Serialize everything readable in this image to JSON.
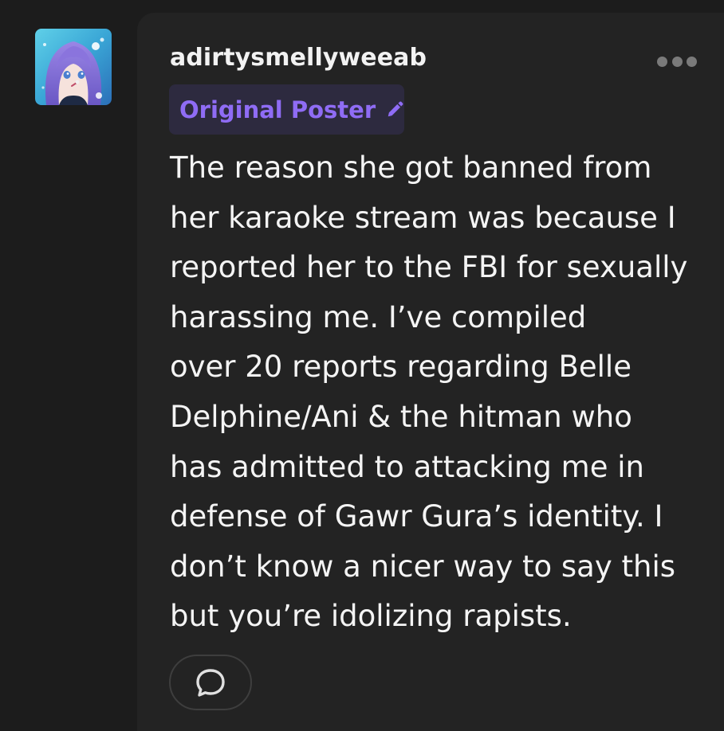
{
  "post": {
    "username": "adirtysmellyweeab",
    "badge": {
      "label": "Original Poster",
      "icon": "pencil-icon",
      "color": "#8f6cf5",
      "background": "#2d2a3f"
    },
    "avatar_icon": "avatar",
    "more_icon": "more-options-icon",
    "body_lines": [
      "The reason she got banned from",
      "her karaoke stream was because I",
      "reported her to the FBI for sexually",
      "harassing me. I’ve compiled",
      "over 20 reports regarding Belle",
      "Delphine/Ani & the hitman who",
      "has admitted to attacking me in",
      "defense of Gawr Gura’s identity. I",
      "don’t know a nicer way to say this",
      "but you’re idolizing rapists."
    ],
    "reply_icon": "speech-bubble-icon"
  },
  "colors": {
    "page_background": "#1c1c1c",
    "card_background": "#232323",
    "text": "#f4f4f4",
    "muted_icon": "#7a7a7a"
  }
}
